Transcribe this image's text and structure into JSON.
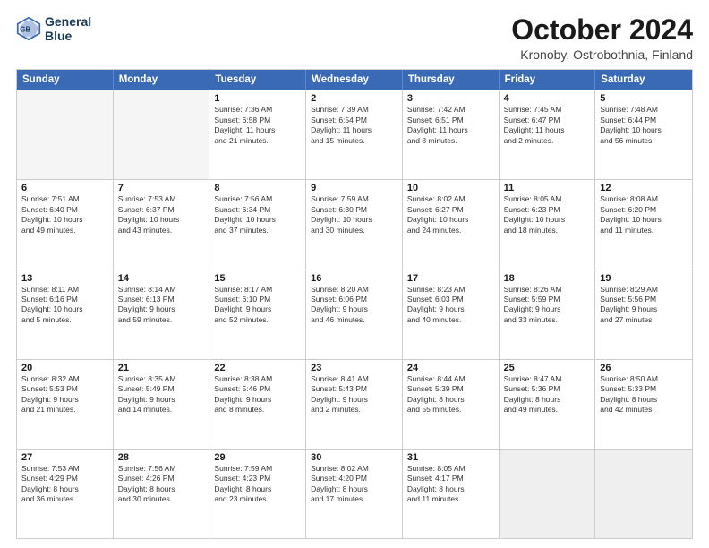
{
  "header": {
    "logo_line1": "General",
    "logo_line2": "Blue",
    "title": "October 2024",
    "subtitle": "Kronoby, Ostrobothnia, Finland"
  },
  "days_of_week": [
    "Sunday",
    "Monday",
    "Tuesday",
    "Wednesday",
    "Thursday",
    "Friday",
    "Saturday"
  ],
  "weeks": [
    [
      {
        "day": "",
        "lines": [],
        "empty": true
      },
      {
        "day": "",
        "lines": [],
        "empty": true
      },
      {
        "day": "1",
        "lines": [
          "Sunrise: 7:36 AM",
          "Sunset: 6:58 PM",
          "Daylight: 11 hours",
          "and 21 minutes."
        ]
      },
      {
        "day": "2",
        "lines": [
          "Sunrise: 7:39 AM",
          "Sunset: 6:54 PM",
          "Daylight: 11 hours",
          "and 15 minutes."
        ]
      },
      {
        "day": "3",
        "lines": [
          "Sunrise: 7:42 AM",
          "Sunset: 6:51 PM",
          "Daylight: 11 hours",
          "and 8 minutes."
        ]
      },
      {
        "day": "4",
        "lines": [
          "Sunrise: 7:45 AM",
          "Sunset: 6:47 PM",
          "Daylight: 11 hours",
          "and 2 minutes."
        ]
      },
      {
        "day": "5",
        "lines": [
          "Sunrise: 7:48 AM",
          "Sunset: 6:44 PM",
          "Daylight: 10 hours",
          "and 56 minutes."
        ]
      }
    ],
    [
      {
        "day": "6",
        "lines": [
          "Sunrise: 7:51 AM",
          "Sunset: 6:40 PM",
          "Daylight: 10 hours",
          "and 49 minutes."
        ]
      },
      {
        "day": "7",
        "lines": [
          "Sunrise: 7:53 AM",
          "Sunset: 6:37 PM",
          "Daylight: 10 hours",
          "and 43 minutes."
        ]
      },
      {
        "day": "8",
        "lines": [
          "Sunrise: 7:56 AM",
          "Sunset: 6:34 PM",
          "Daylight: 10 hours",
          "and 37 minutes."
        ]
      },
      {
        "day": "9",
        "lines": [
          "Sunrise: 7:59 AM",
          "Sunset: 6:30 PM",
          "Daylight: 10 hours",
          "and 30 minutes."
        ]
      },
      {
        "day": "10",
        "lines": [
          "Sunrise: 8:02 AM",
          "Sunset: 6:27 PM",
          "Daylight: 10 hours",
          "and 24 minutes."
        ]
      },
      {
        "day": "11",
        "lines": [
          "Sunrise: 8:05 AM",
          "Sunset: 6:23 PM",
          "Daylight: 10 hours",
          "and 18 minutes."
        ]
      },
      {
        "day": "12",
        "lines": [
          "Sunrise: 8:08 AM",
          "Sunset: 6:20 PM",
          "Daylight: 10 hours",
          "and 11 minutes."
        ]
      }
    ],
    [
      {
        "day": "13",
        "lines": [
          "Sunrise: 8:11 AM",
          "Sunset: 6:16 PM",
          "Daylight: 10 hours",
          "and 5 minutes."
        ]
      },
      {
        "day": "14",
        "lines": [
          "Sunrise: 8:14 AM",
          "Sunset: 6:13 PM",
          "Daylight: 9 hours",
          "and 59 minutes."
        ]
      },
      {
        "day": "15",
        "lines": [
          "Sunrise: 8:17 AM",
          "Sunset: 6:10 PM",
          "Daylight: 9 hours",
          "and 52 minutes."
        ]
      },
      {
        "day": "16",
        "lines": [
          "Sunrise: 8:20 AM",
          "Sunset: 6:06 PM",
          "Daylight: 9 hours",
          "and 46 minutes."
        ]
      },
      {
        "day": "17",
        "lines": [
          "Sunrise: 8:23 AM",
          "Sunset: 6:03 PM",
          "Daylight: 9 hours",
          "and 40 minutes."
        ]
      },
      {
        "day": "18",
        "lines": [
          "Sunrise: 8:26 AM",
          "Sunset: 5:59 PM",
          "Daylight: 9 hours",
          "and 33 minutes."
        ]
      },
      {
        "day": "19",
        "lines": [
          "Sunrise: 8:29 AM",
          "Sunset: 5:56 PM",
          "Daylight: 9 hours",
          "and 27 minutes."
        ]
      }
    ],
    [
      {
        "day": "20",
        "lines": [
          "Sunrise: 8:32 AM",
          "Sunset: 5:53 PM",
          "Daylight: 9 hours",
          "and 21 minutes."
        ]
      },
      {
        "day": "21",
        "lines": [
          "Sunrise: 8:35 AM",
          "Sunset: 5:49 PM",
          "Daylight: 9 hours",
          "and 14 minutes."
        ]
      },
      {
        "day": "22",
        "lines": [
          "Sunrise: 8:38 AM",
          "Sunset: 5:46 PM",
          "Daylight: 9 hours",
          "and 8 minutes."
        ]
      },
      {
        "day": "23",
        "lines": [
          "Sunrise: 8:41 AM",
          "Sunset: 5:43 PM",
          "Daylight: 9 hours",
          "and 2 minutes."
        ]
      },
      {
        "day": "24",
        "lines": [
          "Sunrise: 8:44 AM",
          "Sunset: 5:39 PM",
          "Daylight: 8 hours",
          "and 55 minutes."
        ]
      },
      {
        "day": "25",
        "lines": [
          "Sunrise: 8:47 AM",
          "Sunset: 5:36 PM",
          "Daylight: 8 hours",
          "and 49 minutes."
        ]
      },
      {
        "day": "26",
        "lines": [
          "Sunrise: 8:50 AM",
          "Sunset: 5:33 PM",
          "Daylight: 8 hours",
          "and 42 minutes."
        ]
      }
    ],
    [
      {
        "day": "27",
        "lines": [
          "Sunrise: 7:53 AM",
          "Sunset: 4:29 PM",
          "Daylight: 8 hours",
          "and 36 minutes."
        ]
      },
      {
        "day": "28",
        "lines": [
          "Sunrise: 7:56 AM",
          "Sunset: 4:26 PM",
          "Daylight: 8 hours",
          "and 30 minutes."
        ]
      },
      {
        "day": "29",
        "lines": [
          "Sunrise: 7:59 AM",
          "Sunset: 4:23 PM",
          "Daylight: 8 hours",
          "and 23 minutes."
        ]
      },
      {
        "day": "30",
        "lines": [
          "Sunrise: 8:02 AM",
          "Sunset: 4:20 PM",
          "Daylight: 8 hours",
          "and 17 minutes."
        ]
      },
      {
        "day": "31",
        "lines": [
          "Sunrise: 8:05 AM",
          "Sunset: 4:17 PM",
          "Daylight: 8 hours",
          "and 11 minutes."
        ]
      },
      {
        "day": "",
        "lines": [],
        "empty": true
      },
      {
        "day": "",
        "lines": [],
        "empty": true
      }
    ]
  ]
}
